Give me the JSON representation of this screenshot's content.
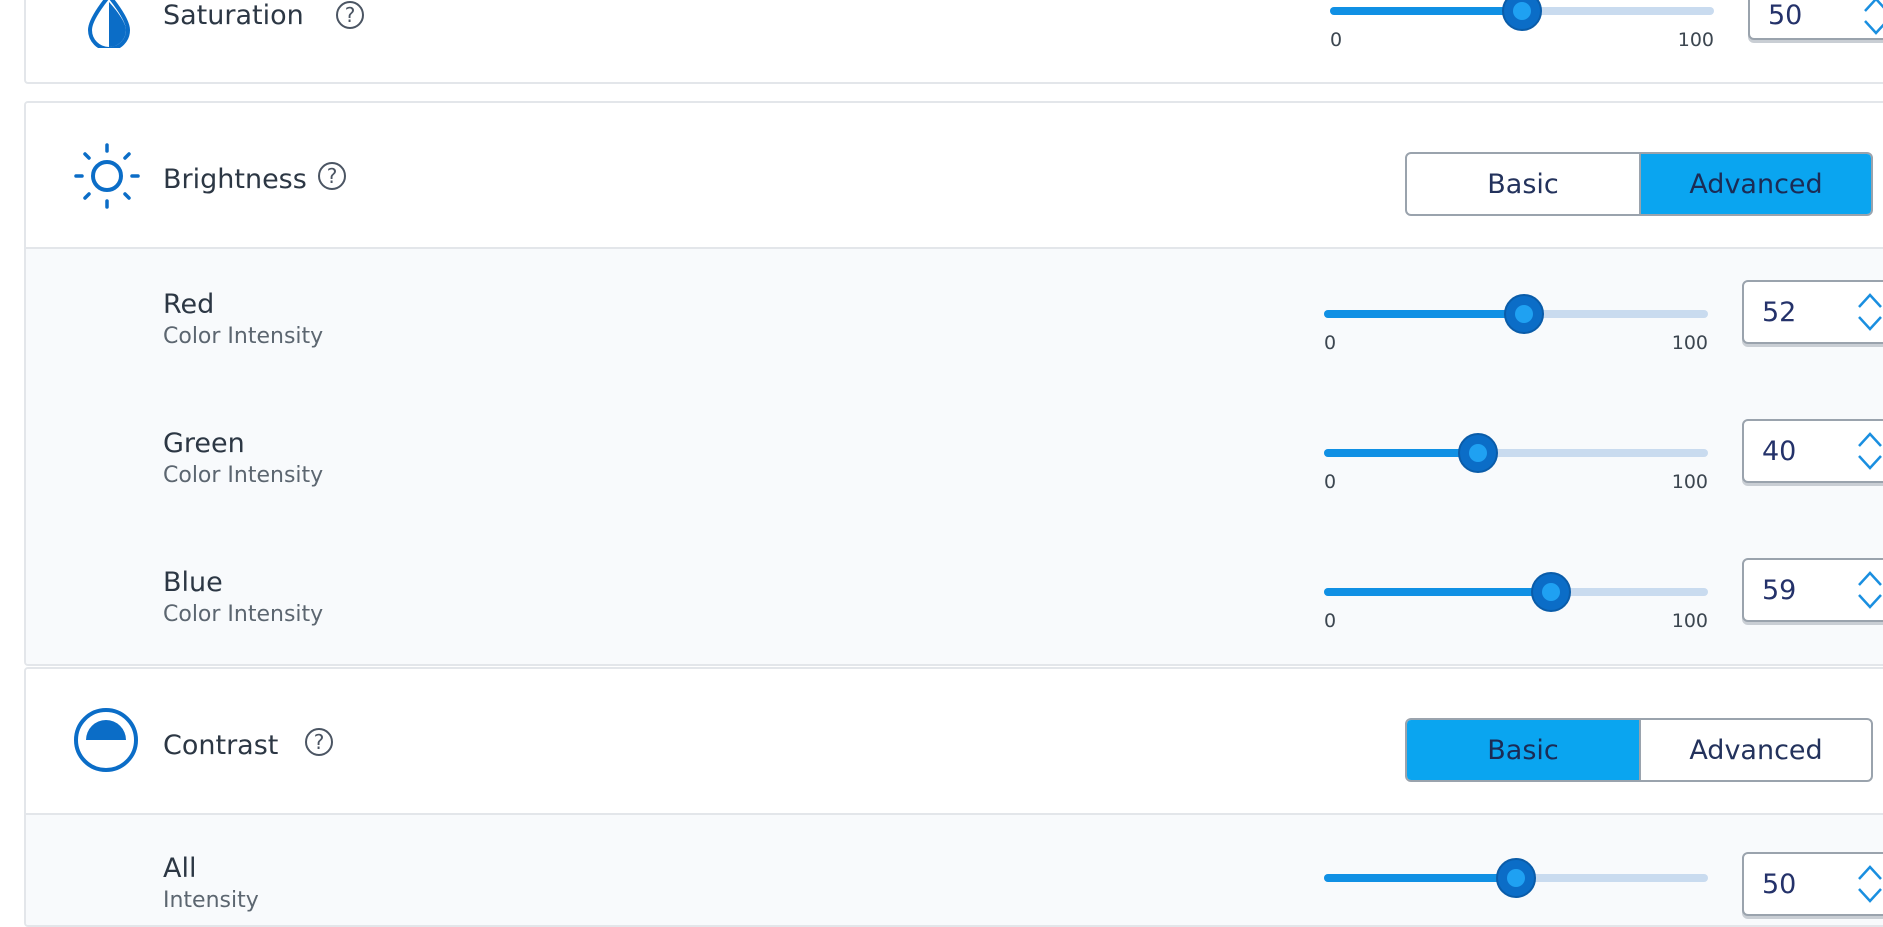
{
  "saturation": {
    "title": "Saturation",
    "help": "?",
    "slider": {
      "value": 50,
      "min": "0",
      "max": "100"
    },
    "spin_value": "50"
  },
  "brightness": {
    "title": "Brightness",
    "help": "?",
    "mode": {
      "basic": "Basic",
      "advanced": "Advanced",
      "selected": "Advanced"
    },
    "rows": [
      {
        "title": "Red",
        "subtitle": "Color Intensity",
        "value": 52,
        "min": "0",
        "max": "100",
        "spin_value": "52"
      },
      {
        "title": "Green",
        "subtitle": "Color Intensity",
        "value": 40,
        "min": "0",
        "max": "100",
        "spin_value": "40"
      },
      {
        "title": "Blue",
        "subtitle": "Color Intensity",
        "value": 59,
        "min": "0",
        "max": "100",
        "spin_value": "59"
      }
    ]
  },
  "contrast": {
    "title": "Contrast",
    "help": "?",
    "mode": {
      "basic": "Basic",
      "advanced": "Advanced",
      "selected": "Basic"
    },
    "rows": [
      {
        "title": "All",
        "subtitle": "Intensity",
        "value": 50,
        "spin_value": "50"
      }
    ]
  },
  "colors": {
    "accent": "#0aa5f0",
    "icon": "#0b6dc7",
    "track": "#c9dbef"
  },
  "icons": {
    "saturation": "droplet-icon",
    "brightness": "sun-icon",
    "contrast": "contrast-icon",
    "help": "help-icon",
    "spinner": "spinner-arrows-icon"
  }
}
